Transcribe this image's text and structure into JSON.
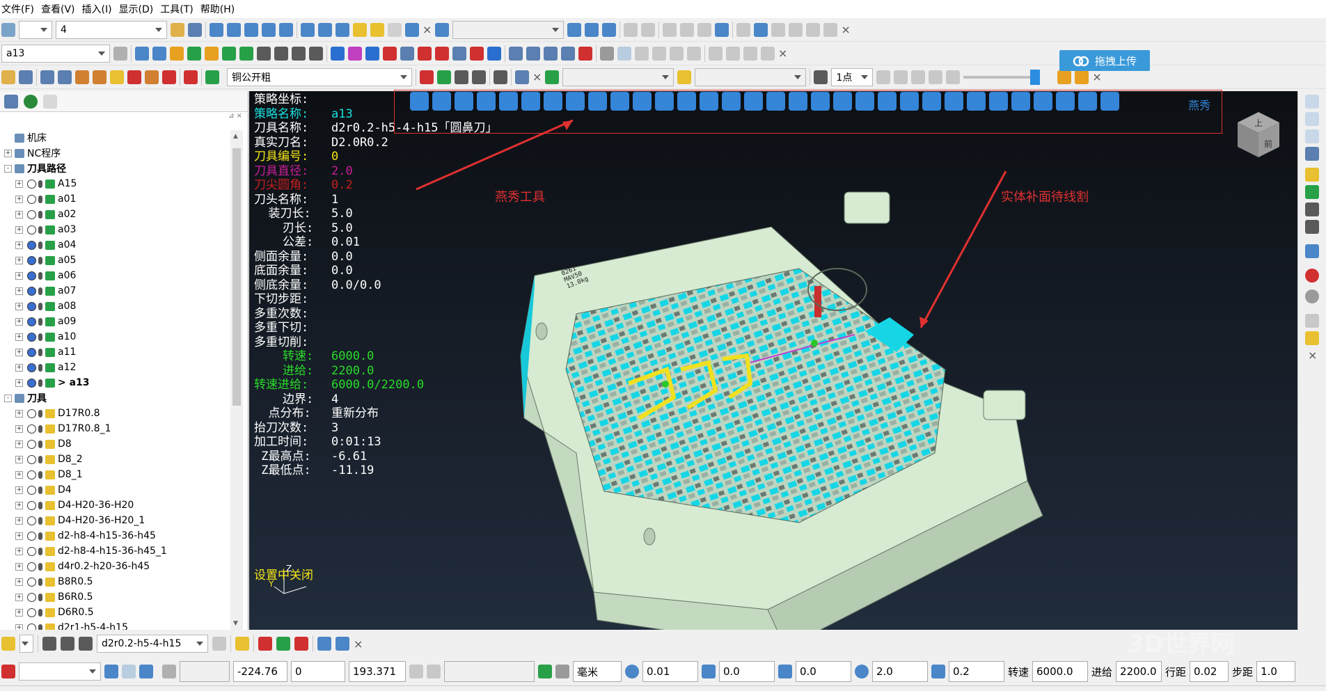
{
  "menu": [
    "文件(F)",
    "查看(V)",
    "插入(I)",
    "显示(D)",
    "工具(T)",
    "帮助(H)"
  ],
  "toolbar1": {
    "layer_value": "4"
  },
  "toolbar2": {
    "path_value": "a13"
  },
  "toolbar3": {
    "template_value": "铜公开粗",
    "points_value": "1点"
  },
  "upload_label": "拖拽上传",
  "tree": [
    {
      "label": "机床",
      "level": 0,
      "expand": "",
      "bold": false
    },
    {
      "label": "NC程序",
      "level": 0,
      "expand": "+",
      "bold": false
    },
    {
      "label": "刀具路径",
      "level": 0,
      "expand": "-",
      "bold": true
    },
    {
      "label": "A15",
      "level": 1,
      "expand": "+",
      "bold": false
    },
    {
      "label": "a01",
      "level": 1,
      "expand": "+",
      "bold": false
    },
    {
      "label": "a02",
      "level": 1,
      "expand": "+",
      "bold": false
    },
    {
      "label": "a03",
      "level": 1,
      "expand": "+",
      "bold": false
    },
    {
      "label": "a04",
      "level": 1,
      "expand": "+",
      "bold": false
    },
    {
      "label": "a05",
      "level": 1,
      "expand": "+",
      "bold": false
    },
    {
      "label": "a06",
      "level": 1,
      "expand": "+",
      "bold": false
    },
    {
      "label": "a07",
      "level": 1,
      "expand": "+",
      "bold": false
    },
    {
      "label": "a08",
      "level": 1,
      "expand": "+",
      "bold": false
    },
    {
      "label": "a09",
      "level": 1,
      "expand": "+",
      "bold": false
    },
    {
      "label": "a10",
      "level": 1,
      "expand": "+",
      "bold": false
    },
    {
      "label": "a11",
      "level": 1,
      "expand": "+",
      "bold": false
    },
    {
      "label": "a12",
      "level": 1,
      "expand": "+",
      "bold": false
    },
    {
      "label": "> a13",
      "level": 1,
      "expand": "+",
      "bold": true
    },
    {
      "label": "刀具",
      "level": 0,
      "expand": "-",
      "bold": true
    },
    {
      "label": "D17R0.8",
      "level": 1,
      "expand": "+",
      "bold": false
    },
    {
      "label": "D17R0.8_1",
      "level": 1,
      "expand": "+",
      "bold": false
    },
    {
      "label": "D8",
      "level": 1,
      "expand": "+",
      "bold": false
    },
    {
      "label": "D8_2",
      "level": 1,
      "expand": "+",
      "bold": false
    },
    {
      "label": "D8_1",
      "level": 1,
      "expand": "+",
      "bold": false
    },
    {
      "label": "D4",
      "level": 1,
      "expand": "+",
      "bold": false
    },
    {
      "label": "D4-H20-36-H20",
      "level": 1,
      "expand": "+",
      "bold": false
    },
    {
      "label": "D4-H20-36-H20_1",
      "level": 1,
      "expand": "+",
      "bold": false
    },
    {
      "label": "d2-h8-4-h15-36-h45",
      "level": 1,
      "expand": "+",
      "bold": false
    },
    {
      "label": "d2-h8-4-h15-36-h45_1",
      "level": 1,
      "expand": "+",
      "bold": false
    },
    {
      "label": "d4r0.2-h20-36-h45",
      "level": 1,
      "expand": "+",
      "bold": false
    },
    {
      "label": "B8R0.5",
      "level": 1,
      "expand": "+",
      "bold": false
    },
    {
      "label": "B6R0.5",
      "level": 1,
      "expand": "+",
      "bold": false
    },
    {
      "label": "D6R0.5",
      "level": 1,
      "expand": "+",
      "bold": false
    },
    {
      "label": "d2r1-h5-4-h15",
      "level": 1,
      "expand": "+",
      "bold": false
    }
  ],
  "path_info": [
    {
      "label": "策略坐标:",
      "value": "",
      "color": "#ffffff"
    },
    {
      "label": "策略名称:",
      "value": "a13",
      "color": "#19e0e0"
    },
    {
      "label": "刀具名称:",
      "value": "d2r0.2-h5-4-h15「圆鼻刀」",
      "color": "#ffffff"
    },
    {
      "label": "真实刀名:",
      "value": "D2.0R0.2",
      "color": "#ffffff"
    },
    {
      "label": "刀具编号:",
      "value": "0",
      "color": "#f5e614"
    },
    {
      "label": "刀具直径:",
      "value": "2.0",
      "color": "#c81e96"
    },
    {
      "label": "刀尖圆角:",
      "value": "0.2",
      "color": "#c81e1e"
    },
    {
      "label": "刀头名称:",
      "value": "1",
      "color": "#ffffff"
    },
    {
      "label": "  装刀长:",
      "value": "5.0",
      "color": "#ffffff"
    },
    {
      "label": "    刃长:",
      "value": "5.0",
      "color": "#ffffff"
    },
    {
      "label": "    公差:",
      "value": "0.01",
      "color": "#ffffff"
    },
    {
      "label": "侧面余量:",
      "value": "0.0",
      "color": "#ffffff"
    },
    {
      "label": "底面余量:",
      "value": "0.0",
      "color": "#ffffff"
    },
    {
      "label": "侧底余量:",
      "value": "0.0/0.0",
      "color": "#ffffff"
    },
    {
      "label": "下切步距:",
      "value": "",
      "color": "#ffffff"
    },
    {
      "label": "多重次数:",
      "value": "",
      "color": "#ffffff"
    },
    {
      "label": "多重下切:",
      "value": "",
      "color": "#ffffff"
    },
    {
      "label": "多重切削:",
      "value": "",
      "color": "#ffffff"
    },
    {
      "label": "    转速:",
      "value": "6000.0",
      "color": "#28dc28"
    },
    {
      "label": "    进给:",
      "value": "2200.0",
      "color": "#28dc28"
    },
    {
      "label": "转速进给:",
      "value": "6000.0/2200.0",
      "color": "#28dc28"
    },
    {
      "label": "    边界:",
      "value": "4",
      "color": "#ffffff"
    },
    {
      "label": "  点分布:",
      "value": "重新分布",
      "color": "#ffffff"
    },
    {
      "label": "抬刀次数:",
      "value": "3",
      "color": "#ffffff"
    },
    {
      "label": "加工时间:",
      "value": "0:01:13",
      "color": "#ffffff"
    },
    {
      "label": " Z最高点:",
      "value": "-6.61",
      "color": "#ffffff"
    },
    {
      "label": " Z最低点:",
      "value": "-11.19",
      "color": "#ffffff"
    }
  ],
  "settings_close": "设置中关闭",
  "axis": {
    "z": "Z",
    "y": "Y"
  },
  "yanxiu_toolbar": {
    "label": "燕秀",
    "annotation": "燕秀工具"
  },
  "model_annotation": "实体补面待线割",
  "viewcube": {
    "top": "上",
    "front": "前"
  },
  "part_engraving": [
    "0261",
    "MAV50",
    "13.0kg"
  ],
  "bottom_toolbar": {
    "tool_value": "d2r0.2-h5-4-h15"
  },
  "status": {
    "x": "-224.76",
    "y": "0",
    "z": "193.371",
    "unit": "毫米",
    "tol": "0.01",
    "v1": "0.0",
    "v2": "0.0",
    "dia": "2.0",
    "corner": "0.2",
    "speed_label": "转速",
    "speed": "6000.0",
    "feed_label": "进给",
    "feed": "2200.0",
    "stepover_label": "行距",
    "stepover": "0.02",
    "stepdown_label": "步距",
    "stepdown": "1.0"
  },
  "watermark": "3D世界网",
  "colors": {
    "model": "#d6ebd1",
    "cyan": "#16d6e6",
    "accent": "#3585d8",
    "annotation": "#e03030"
  }
}
